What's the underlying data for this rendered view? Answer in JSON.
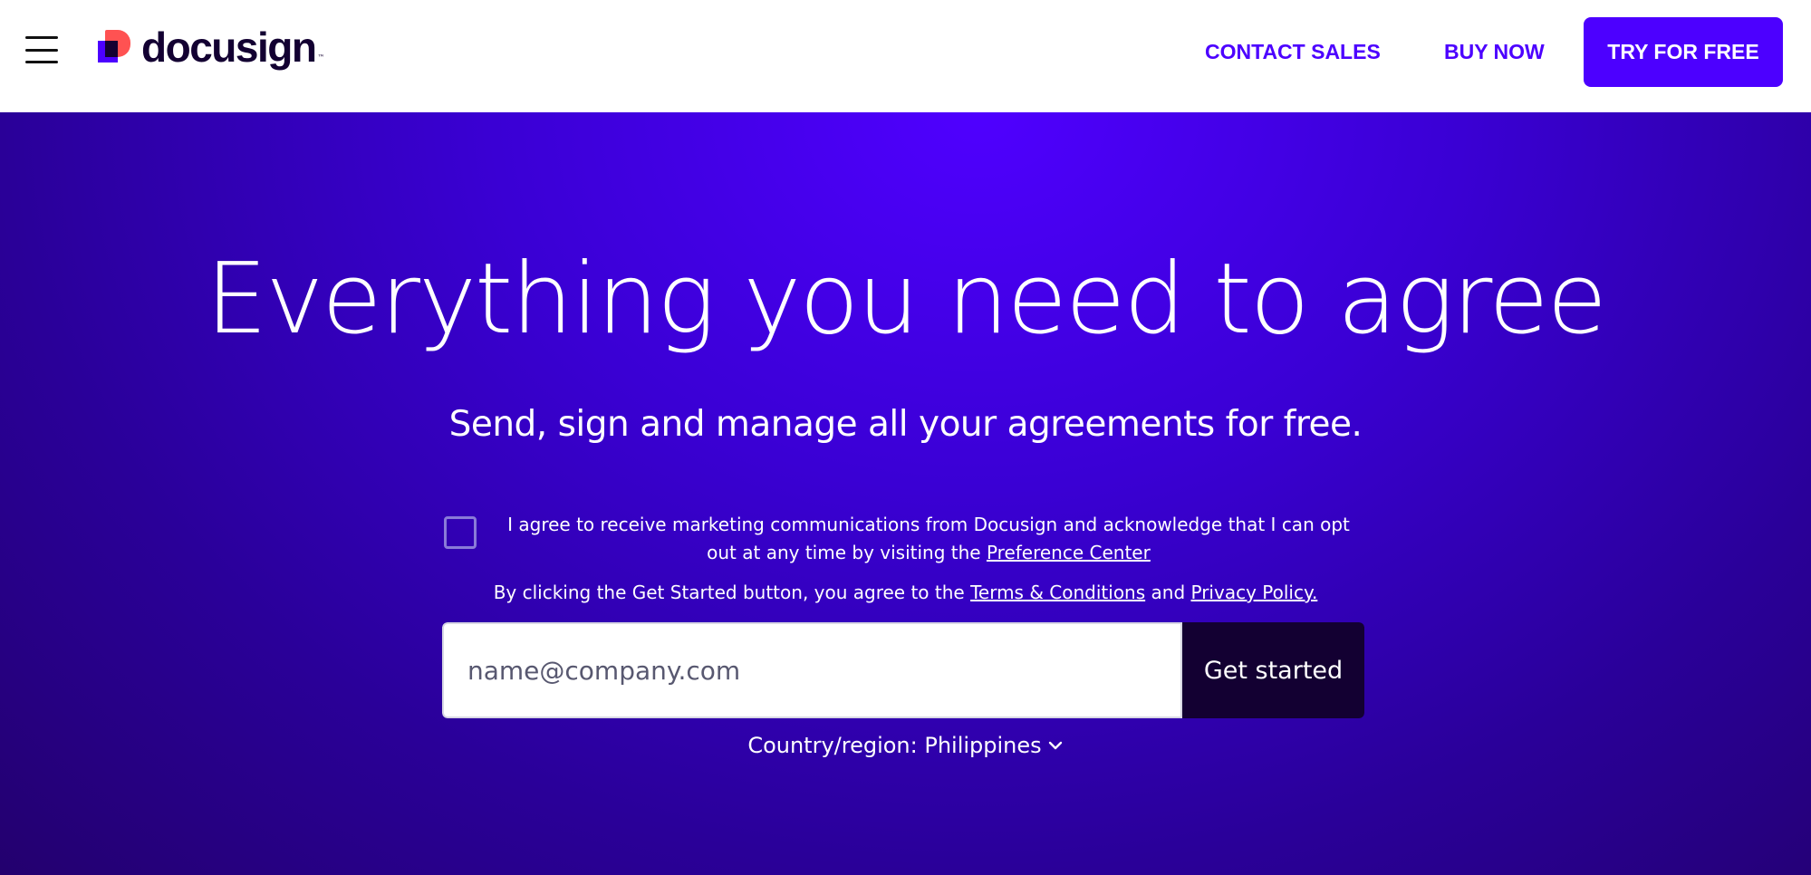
{
  "header": {
    "logo_text": "docusign",
    "logo_tm": "™",
    "contact_sales": "CONTACT SALES",
    "buy_now": "BUY NOW",
    "try_for_free": "TRY FOR FREE"
  },
  "hero": {
    "title": "Everything you need to agree",
    "subtitle": "Send, sign and manage all your agreements for free.",
    "consent_text": "I agree to receive marketing communications from Docusign and acknowledge that I can opt out at any time by visiting the ",
    "preference_center": "Preference Center",
    "terms_prefix": "By clicking the Get Started button, you agree to the ",
    "terms_link": "Terms & Conditions",
    "terms_and": " and ",
    "privacy_link": "Privacy Policy.",
    "email_placeholder": "name@company.com",
    "get_started": "Get started",
    "country_label": "Country/region: Philippines"
  },
  "colors": {
    "brand_purple": "#4c00ff",
    "brand_dark": "#130032",
    "brand_red": "#ff5252"
  }
}
